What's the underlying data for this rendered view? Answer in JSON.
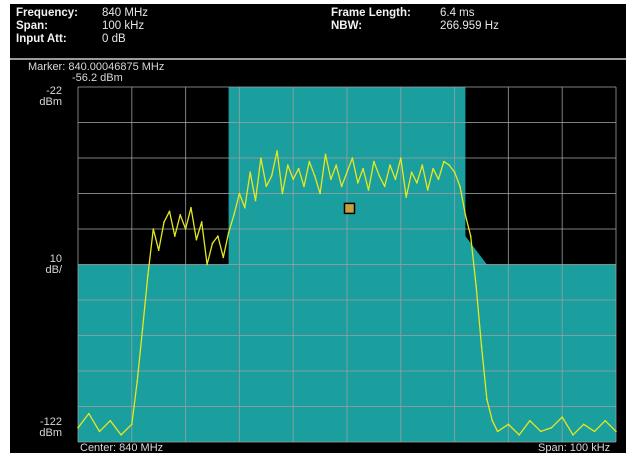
{
  "header": {
    "frequency": {
      "label": "Frequency:",
      "value": "840 MHz"
    },
    "span": {
      "label": "Span:",
      "value": "100 kHz"
    },
    "input_att": {
      "label": "Input Att:",
      "value": "0 dB"
    },
    "frame_length": {
      "label": "Frame Length:",
      "value": "6.4 ms"
    },
    "nbw": {
      "label": "NBW:",
      "value": "266.959 Hz"
    }
  },
  "marker": {
    "frequency_text": "Marker: 840.00046875 MHz",
    "level_text": "-56.2 dBm",
    "marker_frequency_mhz": 840.00046875,
    "marker_level_dbm": -56.2
  },
  "y_axis": {
    "top_value": "-22",
    "top_unit": "dBm",
    "scale_value": "10",
    "scale_unit": "dB/",
    "bottom_value": "-122",
    "bottom_unit": "dBm"
  },
  "footer": {
    "center_text": "Center: 840 MHz",
    "span_text": "Span: 100 kHz"
  },
  "colors": {
    "background": "#000000",
    "mask": "#1a9e9e",
    "grid": "#9aa0a0",
    "trace": "#e6e81e",
    "text": "#d8d8d8"
  },
  "chart_data": {
    "type": "line",
    "xlim": [
      -50,
      50
    ],
    "ylim": [
      -122,
      -22
    ],
    "x_unit": "kHz offset from center",
    "y_unit": "dBm",
    "grid": true,
    "mask": {
      "name": "spectrum emission mask",
      "x": [
        -50,
        -27,
        -22,
        -22,
        22,
        22,
        26,
        50
      ],
      "y": [
        -72,
        -72,
        -72,
        -22,
        -22,
        -64,
        -72,
        -72
      ]
    },
    "trace": {
      "x": [
        -50,
        -48,
        -46,
        -44,
        -42,
        -40,
        -39,
        -38,
        -37,
        -36,
        -35,
        -34,
        -33,
        -32,
        -31,
        -30,
        -29,
        -28,
        -27,
        -26,
        -25,
        -24,
        -23,
        -22,
        -21,
        -20,
        -19,
        -18,
        -17,
        -16,
        -15,
        -14,
        -13,
        -12,
        -11,
        -10,
        -9,
        -8,
        -7,
        -6,
        -5,
        -4,
        -3,
        -2,
        -1,
        0,
        1,
        2,
        3,
        4,
        5,
        6,
        7,
        8,
        9,
        10,
        11,
        12,
        13,
        14,
        15,
        16,
        17,
        18,
        19,
        20,
        21,
        22,
        23,
        24,
        25,
        26,
        27,
        28,
        30,
        32,
        34,
        36,
        38,
        40,
        42,
        44,
        46,
        48,
        50
      ],
      "y": [
        -118,
        -114,
        -119,
        -116,
        -120,
        -117,
        -105,
        -90,
        -75,
        -62,
        -68,
        -60,
        -57,
        -64,
        -58,
        -62,
        -56,
        -65,
        -60,
        -72,
        -66,
        -64,
        -70,
        -63,
        -58,
        -52,
        -56,
        -46,
        -54,
        -42,
        -50,
        -47,
        -40,
        -52,
        -44,
        -48,
        -45,
        -50,
        -43,
        -47,
        -52,
        -41,
        -48,
        -44,
        -50,
        -46,
        -42,
        -49,
        -45,
        -51,
        -43,
        -47,
        -50,
        -44,
        -48,
        -42,
        -53,
        -46,
        -49,
        -44,
        -51,
        -45,
        -48,
        -43,
        -44,
        -46,
        -50,
        -58,
        -64,
        -78,
        -95,
        -110,
        -116,
        -119,
        -117,
        -120,
        -116,
        -119,
        -118,
        -115,
        -120,
        -117,
        -119,
        -116,
        -119
      ]
    }
  }
}
